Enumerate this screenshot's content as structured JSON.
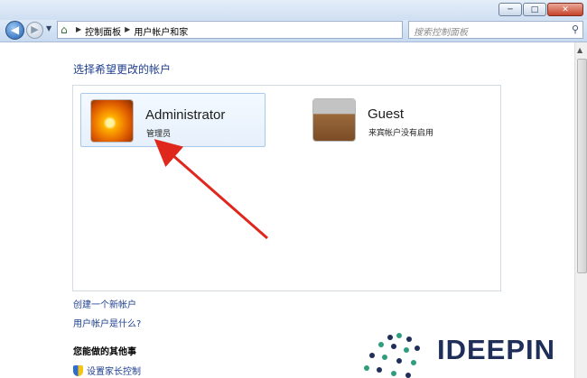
{
  "window": {
    "minimize_glyph": "─",
    "maximize_glyph": "□",
    "close_glyph": "✕"
  },
  "nav": {
    "address_breadcrumbs": [
      "控制面板",
      "用户帐户和家"
    ],
    "search_placeholder": "搜索控制面板"
  },
  "main": {
    "heading": "选择希望更改的帐户",
    "accounts": [
      {
        "name": "Administrator",
        "role": "管理员",
        "picture": "orange-flower-icon"
      },
      {
        "name": "Guest",
        "role": "来宾帐户没有启用",
        "picture": "suitcase-icon"
      }
    ],
    "links": [
      "创建一个新帐户",
      "用户帐户是什么?"
    ],
    "more_heading": "您能做的其他事",
    "parent_control_label": "设置家长控制"
  },
  "watermark": {
    "text": "IDEEPIN"
  },
  "colors": {
    "link": "#1e3f8f",
    "arrow": "#e0271e",
    "selection_bg": "#e6f0fb"
  }
}
